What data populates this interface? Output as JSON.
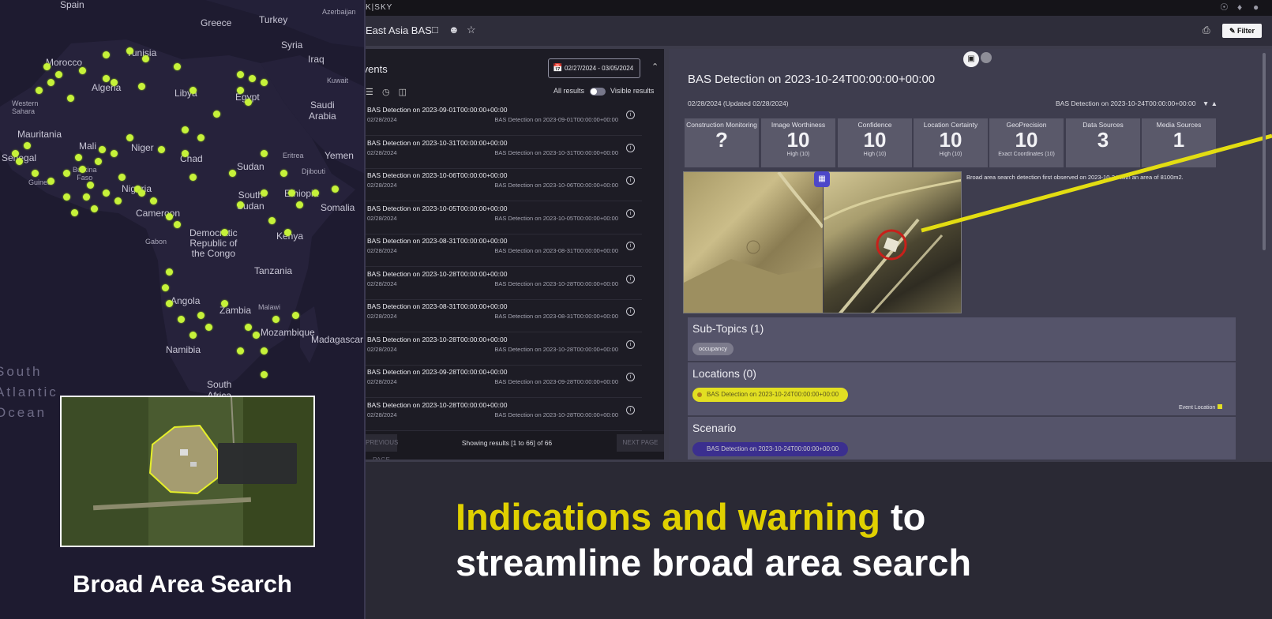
{
  "map": {
    "labels": {
      "spain": "Spain",
      "greece": "Greece",
      "turkey": "Turkey",
      "azerbaijan": "Azerbaijan",
      "syria": "Syria",
      "iraq": "Iraq",
      "kuwait": "Kuwait",
      "morocco": "Morocco",
      "tunisia": "Tunisia",
      "algeria": "Algeria",
      "libya": "Libya",
      "egypt": "Egypt",
      "saudi": "Saudi\nArabia",
      "western_sahara": "Western\nSahara",
      "mauritania": "Mauritania",
      "mali": "Mali",
      "niger": "Niger",
      "chad": "Chad",
      "sudan": "Sudan",
      "eritrea": "Eritrea",
      "yemen": "Yemen",
      "djibouti": "Djibouti",
      "senegal": "Senegal",
      "burkina": "Burkina\nFaso",
      "guinea": "Guinea",
      "nigeria": "Nigeria",
      "ethiopia": "Ethiopia",
      "south_sudan": "South\nSudan",
      "somalia": "Somalia",
      "cameroon": "Cameroon",
      "gabon": "Gabon",
      "drc": "Democratic\nRepublic of\nthe Congo",
      "kenya": "Kenya",
      "tanzania": "Tanzania",
      "angola": "Angola",
      "malawi": "Malawi",
      "zambia": "Zambia",
      "mozambique": "Mozambique",
      "madagascar": "Madagascar",
      "namibia": "Namibia",
      "south_africa": "South\nAfrica",
      "ocean": "South\nAtlantic\nOcean"
    },
    "caption": "Broad Area Search"
  },
  "app": {
    "brand": "K|SKY",
    "workspace_title": "East Asia BAS",
    "filter_label": "Filter",
    "events": {
      "header": "Events",
      "date_range": "02/27/2024 - 03/05/2024",
      "all_results": "All results",
      "visible_results": "Visible results",
      "items": [
        {
          "title": "BAS Detection on 2023-09-01T00:00:00+00:00",
          "date": "02/28/2024",
          "source": "BAS Detection on 2023-09-01T00:00:00+00:00"
        },
        {
          "title": "BAS Detection on 2023-10-31T00:00:00+00:00",
          "date": "02/28/2024",
          "source": "BAS Detection on 2023-10-31T00:00:00+00:00"
        },
        {
          "title": "BAS Detection on 2023-10-06T00:00:00+00:00",
          "date": "02/28/2024",
          "source": "BAS Detection on 2023-10-06T00:00:00+00:00"
        },
        {
          "title": "BAS Detection on 2023-10-05T00:00:00+00:00",
          "date": "02/28/2024",
          "source": "BAS Detection on 2023-10-05T00:00:00+00:00"
        },
        {
          "title": "BAS Detection on 2023-08-31T00:00:00+00:00",
          "date": "02/28/2024",
          "source": "BAS Detection on 2023-08-31T00:00:00+00:00"
        },
        {
          "title": "BAS Detection on 2023-10-28T00:00:00+00:00",
          "date": "02/28/2024",
          "source": "BAS Detection on 2023-10-28T00:00:00+00:00"
        },
        {
          "title": "BAS Detection on 2023-08-31T00:00:00+00:00",
          "date": "02/28/2024",
          "source": "BAS Detection on 2023-08-31T00:00:00+00:00"
        },
        {
          "title": "BAS Detection on 2023-10-28T00:00:00+00:00",
          "date": "02/28/2024",
          "source": "BAS Detection on 2023-10-28T00:00:00+00:00"
        },
        {
          "title": "BAS Detection on 2023-09-28T00:00:00+00:00",
          "date": "02/28/2024",
          "source": "BAS Detection on 2023-09-28T00:00:00+00:00"
        },
        {
          "title": "BAS Detection on 2023-10-28T00:00:00+00:00",
          "date": "02/28/2024",
          "source": "BAS Detection on 2023-10-28T00:00:00+00:00"
        }
      ],
      "prev_label": "PREVIOUS PAGE",
      "next_label": "NEXT PAGE",
      "results_count": "Showing results [1 to 66] of 66"
    },
    "detail": {
      "title": "BAS Detection on 2023-10-24T00:00:00+00:00",
      "dates": "02/28/2024  (Updated 02/28/2024)",
      "source": "BAS Detection on 2023-10-24T00:00:00+00:00",
      "metrics": [
        {
          "label": "Construction Monitoring",
          "value": "?",
          "sub": ""
        },
        {
          "label": "Image Worthiness",
          "value": "10",
          "sub": "High (10)"
        },
        {
          "label": "Confidence",
          "value": "10",
          "sub": "High (10)"
        },
        {
          "label": "Location Certainty",
          "value": "10",
          "sub": "High (10)"
        },
        {
          "label": "GeoPrecision",
          "value": "10",
          "sub": "Exact Coordinates (10)"
        },
        {
          "label": "Data Sources",
          "value": "3",
          "sub": ""
        },
        {
          "label": "Media Sources",
          "value": "1",
          "sub": ""
        }
      ],
      "image_description": "Broad area search detection first observed on 2023-10-24 with an area of 8100m2.",
      "subtopics_header": "Sub-Topics (1)",
      "subtopic_chip": "occupancy",
      "locations_header": "Locations (0)",
      "location_chip": "BAS Detection on 2023-10-24T00:00:00+00:00",
      "location_legend": "Event Location",
      "scenario_header": "Scenario",
      "scenario_chip": "BAS Detection on 2023-10-24T00:00:00+00:00"
    }
  },
  "caption": {
    "highlight": "Indications and warning",
    "rest1": " to",
    "line2": "streamline broad area search"
  },
  "colors": {
    "detection_dot": "#c6f23a",
    "highlight_text": "#e0d000",
    "location_chip": "#e2df22"
  }
}
